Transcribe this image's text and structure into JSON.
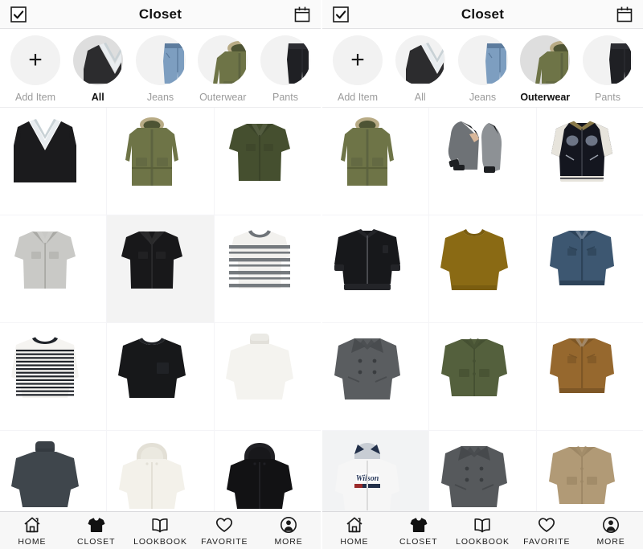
{
  "screens": [
    {
      "id": "closet-all",
      "header": {
        "title": "Closet",
        "left_icon": "checkbox-check-icon",
        "right_icon": "calendar-icon"
      },
      "categories": [
        {
          "label": "Add Item",
          "icon": "plus-icon",
          "selected": false
        },
        {
          "label": "All",
          "icon": "vest-icon",
          "selected": true
        },
        {
          "label": "Jeans",
          "icon": "jeans-icon",
          "selected": false
        },
        {
          "label": "Outerwear",
          "icon": "parka-icon",
          "selected": false
        },
        {
          "label": "Pants",
          "icon": "pants-icon",
          "selected": false
        }
      ],
      "items": [
        {
          "name": "black-knit-vest",
          "kind": "vest",
          "color": "#1b1b1d",
          "accent": "#e8ecef"
        },
        {
          "name": "olive-hooded-parka",
          "kind": "parka",
          "color": "#6e7447",
          "accent": "#b8ab85"
        },
        {
          "name": "olive-short-sleeve-work-shirt",
          "kind": "shortshirt",
          "color": "#454f2f",
          "accent": "#3a4328"
        },
        {
          "name": "grey-printed-short-sleeve-shirt",
          "kind": "shortshirt",
          "color": "#c9c9c6",
          "accent": "#a9a9a5"
        },
        {
          "name": "black-open-collar-shirt",
          "kind": "shortshirt",
          "color": "#18181a",
          "accent": "#2a2a2c",
          "bg": "#f3f3f3"
        },
        {
          "name": "grey-striped-tee",
          "kind": "stripetee",
          "color": "#f2f1ee",
          "accent": "#6f7479"
        },
        {
          "name": "striped-long-sleeve-tee",
          "kind": "stripelong",
          "color": "#f5f4f1",
          "accent": "#20242a"
        },
        {
          "name": "black-three-quarter-sleeve-tee",
          "kind": "longtee",
          "color": "#17181a",
          "accent": "#202226"
        },
        {
          "name": "white-turtleneck",
          "kind": "turtleneck",
          "color": "#f4f3ef",
          "accent": "#e2e0da"
        },
        {
          "name": "charcoal-turtleneck",
          "kind": "turtleneck",
          "color": "#3f464c",
          "accent": "#343a40"
        },
        {
          "name": "cream-hoodie",
          "kind": "hoodie",
          "color": "#f3f1ea",
          "accent": "#e3e0d6"
        },
        {
          "name": "black-zip-hoodie",
          "kind": "hoodie",
          "color": "#121214",
          "accent": "#202024"
        }
      ]
    },
    {
      "id": "closet-outerwear",
      "header": {
        "title": "Closet",
        "left_icon": "checkbox-check-icon",
        "right_icon": "calendar-icon"
      },
      "categories": [
        {
          "label": "Add Item",
          "icon": "plus-icon",
          "selected": false
        },
        {
          "label": "All",
          "icon": "vest-icon",
          "selected": false
        },
        {
          "label": "Jeans",
          "icon": "jeans-icon",
          "selected": false
        },
        {
          "label": "Outerwear",
          "icon": "parka-icon",
          "selected": true
        },
        {
          "label": "Pants",
          "icon": "pants-icon",
          "selected": false
        }
      ],
      "items": [
        {
          "name": "olive-hooded-parka",
          "kind": "parka",
          "color": "#6e7447",
          "accent": "#b8ab85"
        },
        {
          "name": "grey-bomber-jacket-pair",
          "kind": "bomberpair",
          "color": "#6e7276",
          "accent": "#1d1f22"
        },
        {
          "name": "navy-souvenir-jacket",
          "kind": "souvenir",
          "color": "#14161f",
          "accent": "#e7e4dc"
        },
        {
          "name": "black-ma1-bomber-jacket",
          "kind": "bomber",
          "color": "#17181b",
          "accent": "#232428"
        },
        {
          "name": "mustard-crewneck-sweater",
          "kind": "sweater",
          "color": "#8a6a14",
          "accent": "#7a5d10"
        },
        {
          "name": "denim-trucker-jacket",
          "kind": "denim",
          "color": "#3d5771",
          "accent": "#2d4359"
        },
        {
          "name": "grey-double-breasted-peacoat",
          "kind": "peacoat",
          "color": "#5a5d60",
          "accent": "#494c4f"
        },
        {
          "name": "olive-military-shirt-jacket",
          "kind": "shirtjacket",
          "color": "#54603d",
          "accent": "#455032"
        },
        {
          "name": "brown-suede-trucker-jacket",
          "kind": "denim",
          "color": "#96682e",
          "accent": "#7e5726"
        },
        {
          "name": "white-wilson-hooded-jacket",
          "kind": "wilson",
          "color": "#f6f6f6",
          "accent": "#23304a",
          "bg": "#f2f3f4",
          "brand": "Wilson"
        },
        {
          "name": "grey-peacoat",
          "kind": "peacoat",
          "color": "#56595c",
          "accent": "#46494c"
        },
        {
          "name": "tan-coach-jacket",
          "kind": "shirtjacket",
          "color": "#b19a76",
          "accent": "#9d8765"
        }
      ]
    }
  ],
  "tabbar": {
    "tabs": [
      {
        "label": "HOME",
        "icon": "home-icon",
        "active": false
      },
      {
        "label": "CLOSET",
        "icon": "tshirt-icon",
        "active": true
      },
      {
        "label": "LOOKBOOK",
        "icon": "book-icon",
        "active": false
      },
      {
        "label": "FAVORITE",
        "icon": "heart-icon",
        "active": false
      },
      {
        "label": "MORE",
        "icon": "person-circle-icon",
        "active": false
      }
    ]
  },
  "colors": {
    "background": "#ffffff",
    "nav_background": "#fafafa",
    "grid_line": "#f4f4f7",
    "circle": "#f2f2f2",
    "circle_selected": "#dedede",
    "label_inactive": "#9b9b9b",
    "label_active": "#111111",
    "tabbar_background": "#f7f7f7"
  }
}
